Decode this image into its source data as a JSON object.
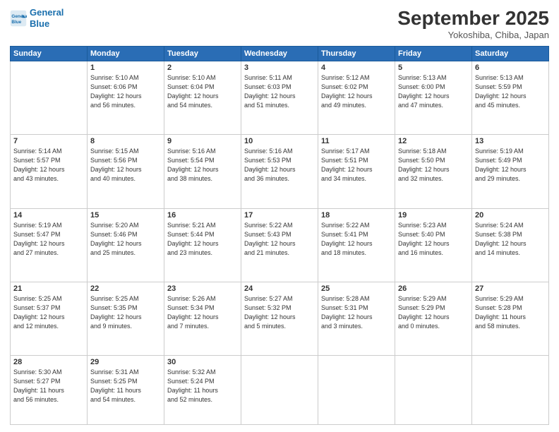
{
  "header": {
    "logo_line1": "General",
    "logo_line2": "Blue",
    "month": "September 2025",
    "location": "Yokoshiba, Chiba, Japan"
  },
  "days_of_week": [
    "Sunday",
    "Monday",
    "Tuesday",
    "Wednesday",
    "Thursday",
    "Friday",
    "Saturday"
  ],
  "weeks": [
    [
      {
        "num": "",
        "info": ""
      },
      {
        "num": "1",
        "info": "Sunrise: 5:10 AM\nSunset: 6:06 PM\nDaylight: 12 hours\nand 56 minutes."
      },
      {
        "num": "2",
        "info": "Sunrise: 5:10 AM\nSunset: 6:04 PM\nDaylight: 12 hours\nand 54 minutes."
      },
      {
        "num": "3",
        "info": "Sunrise: 5:11 AM\nSunset: 6:03 PM\nDaylight: 12 hours\nand 51 minutes."
      },
      {
        "num": "4",
        "info": "Sunrise: 5:12 AM\nSunset: 6:02 PM\nDaylight: 12 hours\nand 49 minutes."
      },
      {
        "num": "5",
        "info": "Sunrise: 5:13 AM\nSunset: 6:00 PM\nDaylight: 12 hours\nand 47 minutes."
      },
      {
        "num": "6",
        "info": "Sunrise: 5:13 AM\nSunset: 5:59 PM\nDaylight: 12 hours\nand 45 minutes."
      }
    ],
    [
      {
        "num": "7",
        "info": "Sunrise: 5:14 AM\nSunset: 5:57 PM\nDaylight: 12 hours\nand 43 minutes."
      },
      {
        "num": "8",
        "info": "Sunrise: 5:15 AM\nSunset: 5:56 PM\nDaylight: 12 hours\nand 40 minutes."
      },
      {
        "num": "9",
        "info": "Sunrise: 5:16 AM\nSunset: 5:54 PM\nDaylight: 12 hours\nand 38 minutes."
      },
      {
        "num": "10",
        "info": "Sunrise: 5:16 AM\nSunset: 5:53 PM\nDaylight: 12 hours\nand 36 minutes."
      },
      {
        "num": "11",
        "info": "Sunrise: 5:17 AM\nSunset: 5:51 PM\nDaylight: 12 hours\nand 34 minutes."
      },
      {
        "num": "12",
        "info": "Sunrise: 5:18 AM\nSunset: 5:50 PM\nDaylight: 12 hours\nand 32 minutes."
      },
      {
        "num": "13",
        "info": "Sunrise: 5:19 AM\nSunset: 5:49 PM\nDaylight: 12 hours\nand 29 minutes."
      }
    ],
    [
      {
        "num": "14",
        "info": "Sunrise: 5:19 AM\nSunset: 5:47 PM\nDaylight: 12 hours\nand 27 minutes."
      },
      {
        "num": "15",
        "info": "Sunrise: 5:20 AM\nSunset: 5:46 PM\nDaylight: 12 hours\nand 25 minutes."
      },
      {
        "num": "16",
        "info": "Sunrise: 5:21 AM\nSunset: 5:44 PM\nDaylight: 12 hours\nand 23 minutes."
      },
      {
        "num": "17",
        "info": "Sunrise: 5:22 AM\nSunset: 5:43 PM\nDaylight: 12 hours\nand 21 minutes."
      },
      {
        "num": "18",
        "info": "Sunrise: 5:22 AM\nSunset: 5:41 PM\nDaylight: 12 hours\nand 18 minutes."
      },
      {
        "num": "19",
        "info": "Sunrise: 5:23 AM\nSunset: 5:40 PM\nDaylight: 12 hours\nand 16 minutes."
      },
      {
        "num": "20",
        "info": "Sunrise: 5:24 AM\nSunset: 5:38 PM\nDaylight: 12 hours\nand 14 minutes."
      }
    ],
    [
      {
        "num": "21",
        "info": "Sunrise: 5:25 AM\nSunset: 5:37 PM\nDaylight: 12 hours\nand 12 minutes."
      },
      {
        "num": "22",
        "info": "Sunrise: 5:25 AM\nSunset: 5:35 PM\nDaylight: 12 hours\nand 9 minutes."
      },
      {
        "num": "23",
        "info": "Sunrise: 5:26 AM\nSunset: 5:34 PM\nDaylight: 12 hours\nand 7 minutes."
      },
      {
        "num": "24",
        "info": "Sunrise: 5:27 AM\nSunset: 5:32 PM\nDaylight: 12 hours\nand 5 minutes."
      },
      {
        "num": "25",
        "info": "Sunrise: 5:28 AM\nSunset: 5:31 PM\nDaylight: 12 hours\nand 3 minutes."
      },
      {
        "num": "26",
        "info": "Sunrise: 5:29 AM\nSunset: 5:29 PM\nDaylight: 12 hours\nand 0 minutes."
      },
      {
        "num": "27",
        "info": "Sunrise: 5:29 AM\nSunset: 5:28 PM\nDaylight: 11 hours\nand 58 minutes."
      }
    ],
    [
      {
        "num": "28",
        "info": "Sunrise: 5:30 AM\nSunset: 5:27 PM\nDaylight: 11 hours\nand 56 minutes."
      },
      {
        "num": "29",
        "info": "Sunrise: 5:31 AM\nSunset: 5:25 PM\nDaylight: 11 hours\nand 54 minutes."
      },
      {
        "num": "30",
        "info": "Sunrise: 5:32 AM\nSunset: 5:24 PM\nDaylight: 11 hours\nand 52 minutes."
      },
      {
        "num": "",
        "info": ""
      },
      {
        "num": "",
        "info": ""
      },
      {
        "num": "",
        "info": ""
      },
      {
        "num": "",
        "info": ""
      }
    ]
  ]
}
